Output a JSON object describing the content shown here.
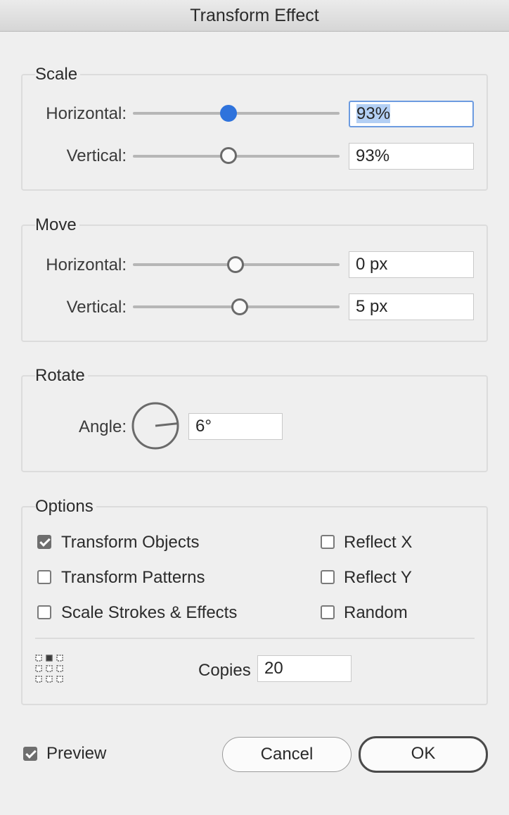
{
  "window": {
    "title": "Transform Effect"
  },
  "scale": {
    "label": "Scale",
    "horizontal": {
      "label": "Horizontal:",
      "value": "93%",
      "slider_fraction": 0.47
    },
    "vertical": {
      "label": "Vertical:",
      "value": "93%",
      "slider_fraction": 0.47
    }
  },
  "move": {
    "label": "Move",
    "horizontal": {
      "label": "Horizontal:",
      "value": "0 px",
      "slider_fraction": 0.5
    },
    "vertical": {
      "label": "Vertical:",
      "value": "5 px",
      "slider_fraction": 0.52
    }
  },
  "rotate": {
    "label": "Rotate",
    "angle_label": "Angle:",
    "angle_value": "6°",
    "angle_degrees": 6
  },
  "options": {
    "label": "Options",
    "transform_objects": {
      "label": "Transform Objects",
      "checked": true
    },
    "transform_patterns": {
      "label": "Transform Patterns",
      "checked": false
    },
    "scale_strokes": {
      "label": "Scale Strokes & Effects",
      "checked": false
    },
    "reflect_x": {
      "label": "Reflect X",
      "checked": false
    },
    "reflect_y": {
      "label": "Reflect Y",
      "checked": false
    },
    "random": {
      "label": "Random",
      "checked": false
    },
    "reference_point_icon": "reference-point-grid-icon",
    "copies_label": "Copies",
    "copies_value": "20"
  },
  "footer": {
    "preview": {
      "label": "Preview",
      "checked": true
    },
    "cancel_label": "Cancel",
    "ok_label": "OK"
  },
  "colors": {
    "accent": "#2f73dc",
    "selection": "#b3cff4",
    "focus_ring": "#6c9be0"
  }
}
